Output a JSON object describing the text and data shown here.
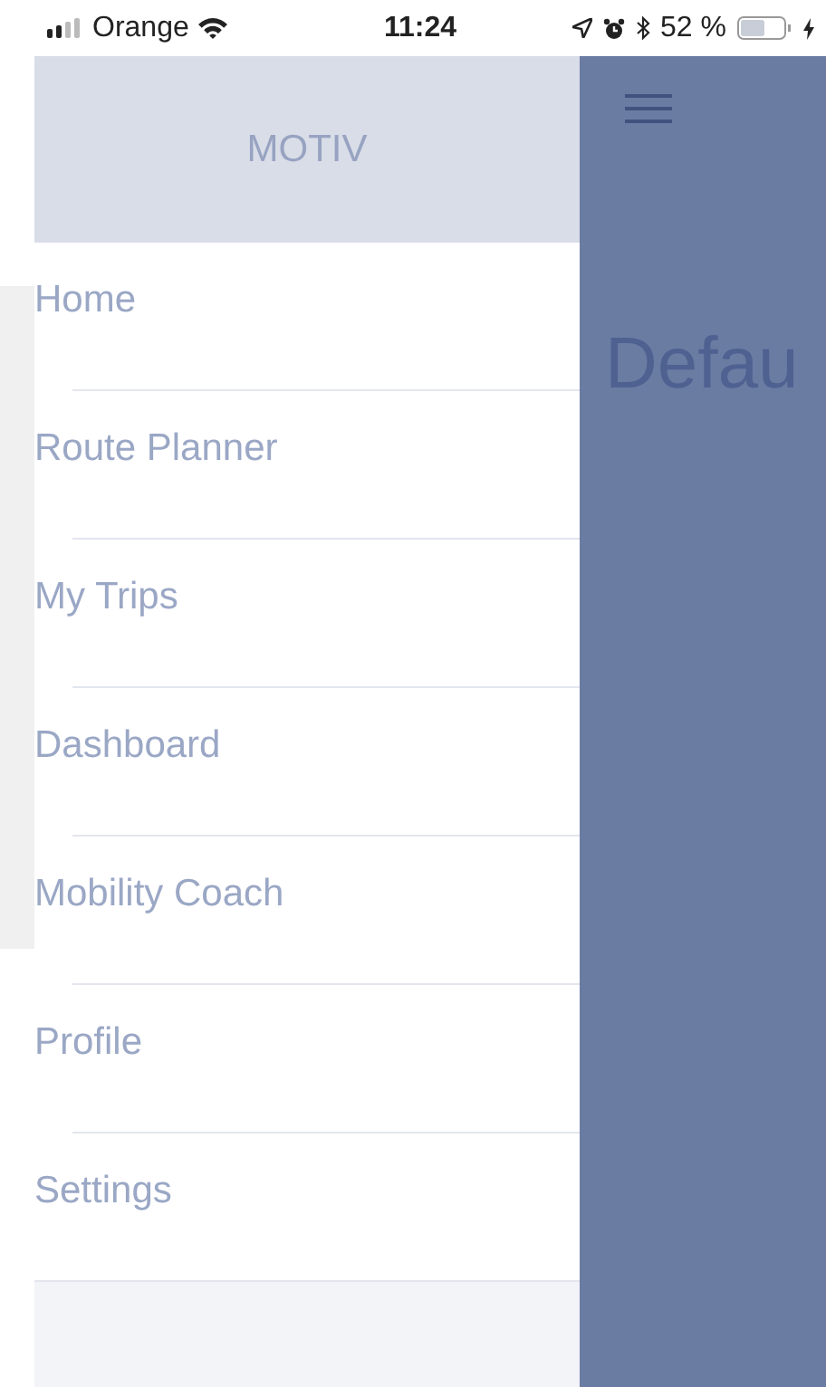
{
  "status_bar": {
    "carrier": "Orange",
    "time": "11:24",
    "battery": "52 %"
  },
  "drawer": {
    "title": "MOTIV",
    "items": [
      {
        "label": "Home"
      },
      {
        "label": "Route Planner"
      },
      {
        "label": "My Trips"
      },
      {
        "label": "Dashboard"
      },
      {
        "label": "Mobility Coach"
      },
      {
        "label": "Profile"
      },
      {
        "label": "Settings"
      }
    ]
  },
  "main": {
    "heading": "Defau"
  }
}
